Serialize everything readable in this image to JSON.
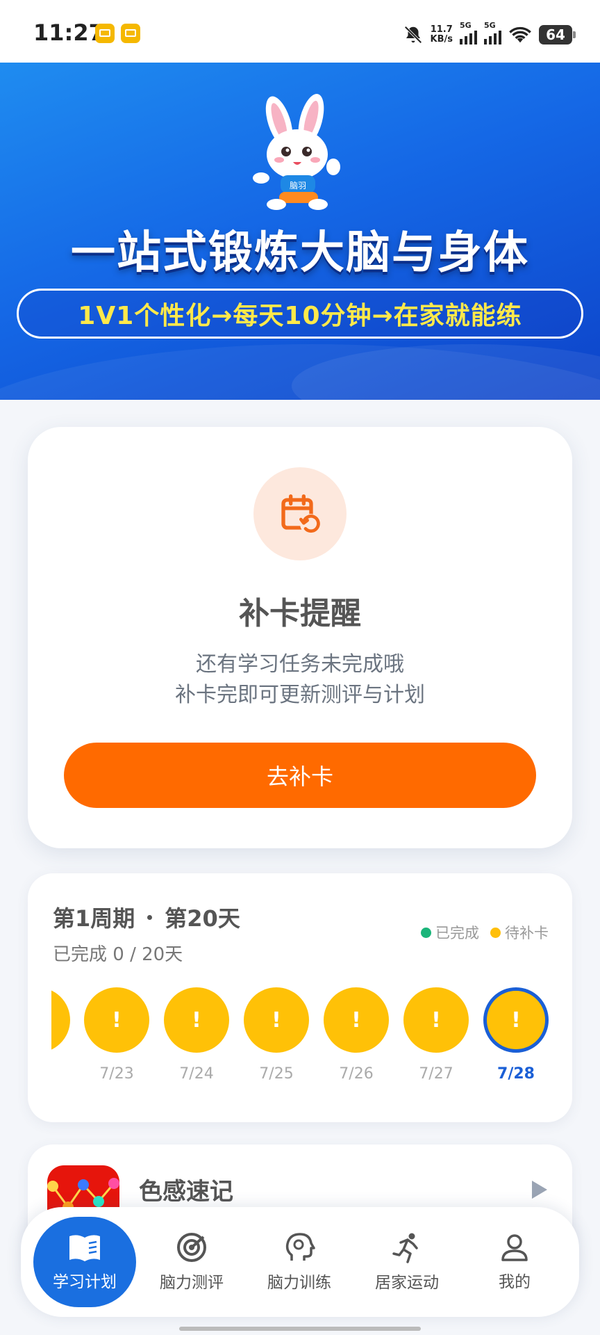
{
  "status_bar": {
    "time": "11:27",
    "net_speed_value": "11.7",
    "net_speed_unit": "KB/s",
    "sim1": "5G",
    "sim2": "5G",
    "battery": "64"
  },
  "banner": {
    "mascot_badge": "脑羽",
    "title": "一站式锻炼大脑与身体",
    "tagline": "1V1个性化→每天10分钟→在家就能练"
  },
  "reminder": {
    "title": "补卡提醒",
    "desc_line1": "还有学习任务未完成哦",
    "desc_line2": "补卡完即可更新测评与计划",
    "button": "去补卡",
    "icon": "calendar-refresh-icon"
  },
  "cycle": {
    "cycle_label": "第1周期",
    "day_label": "第20天",
    "progress_text": "已完成 0 / 20天",
    "legend": [
      {
        "label": "已完成",
        "color": "#1bb57a"
      },
      {
        "label": "待补卡",
        "color": "#ffbf0a"
      }
    ],
    "days": [
      {
        "date": "7/23",
        "mark": "!",
        "status": "pending"
      },
      {
        "date": "7/24",
        "mark": "!",
        "status": "pending"
      },
      {
        "date": "7/25",
        "mark": "!",
        "status": "pending"
      },
      {
        "date": "7/26",
        "mark": "!",
        "status": "pending"
      },
      {
        "date": "7/27",
        "mark": "!",
        "status": "pending"
      },
      {
        "date": "7/28",
        "mark": "!",
        "status": "pending-current"
      }
    ]
  },
  "game": {
    "title": "色感速记"
  },
  "bottom_nav": [
    {
      "label": "学习计划",
      "icon": "book-icon",
      "active": true
    },
    {
      "label": "脑力测评",
      "icon": "radar-icon",
      "active": false
    },
    {
      "label": "脑力训练",
      "icon": "brain-head-icon",
      "active": false
    },
    {
      "label": "居家运动",
      "icon": "running-icon",
      "active": false
    },
    {
      "label": "我的",
      "icon": "user-icon",
      "active": false
    }
  ],
  "colors": {
    "primary_blue": "#1a6fe0",
    "accent_orange": "#ff6a00",
    "pending_yellow": "#ffc107",
    "done_green": "#1bb57a"
  }
}
